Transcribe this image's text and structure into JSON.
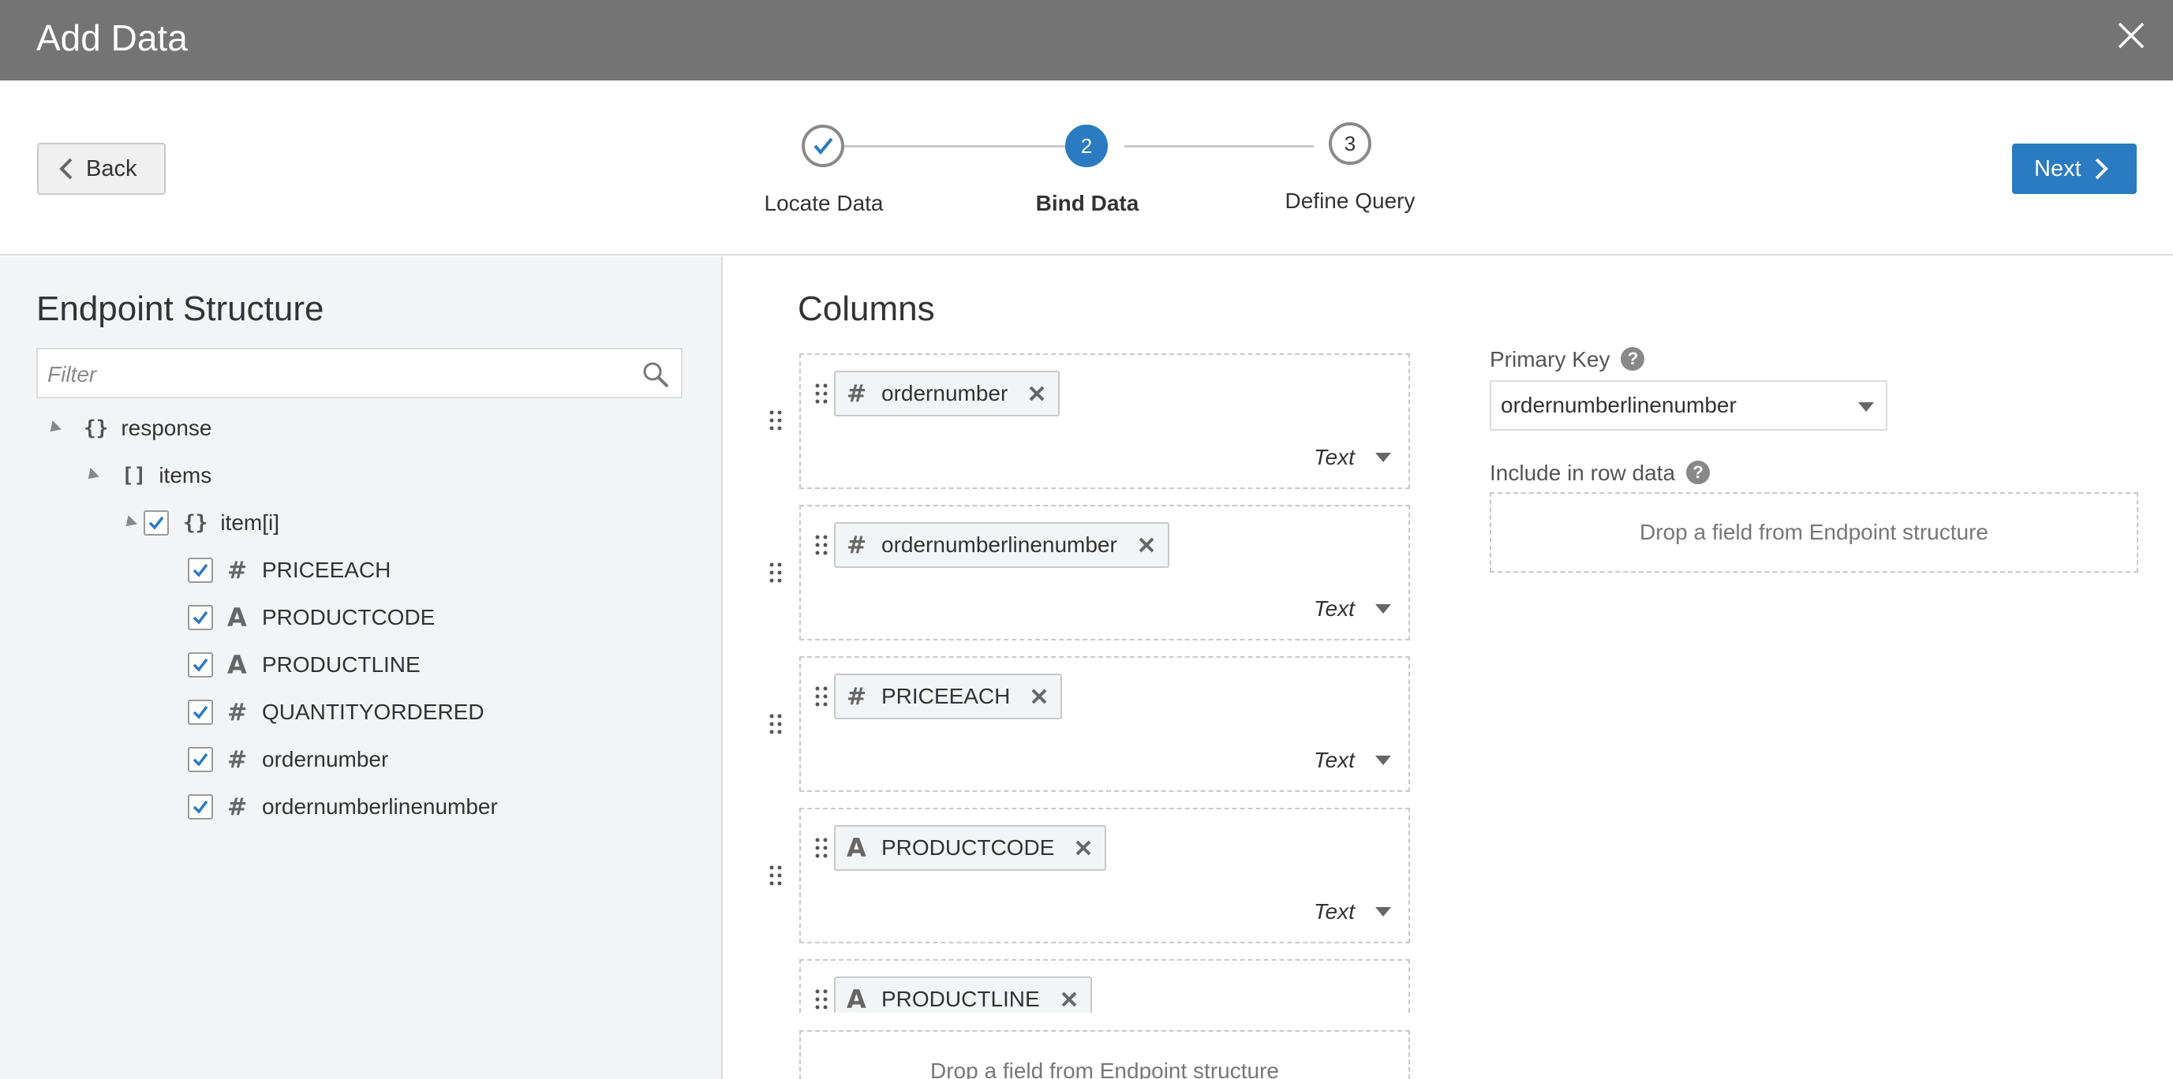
{
  "dialog": {
    "title": "Add Data"
  },
  "wizard": {
    "back_label": "Back",
    "next_label": "Next",
    "steps": [
      {
        "number": "",
        "label": "Locate Data",
        "state": "complete"
      },
      {
        "number": "2",
        "label": "Bind Data",
        "state": "active"
      },
      {
        "number": "3",
        "label": "Define Query",
        "state": "pending"
      }
    ]
  },
  "endpoint": {
    "title": "Endpoint Structure",
    "filter_placeholder": "Filter",
    "tree": [
      {
        "label": "response",
        "kind": "object"
      },
      {
        "label": "items",
        "kind": "array"
      },
      {
        "label": "item[i]",
        "kind": "object",
        "checked": true
      },
      {
        "label": "PRICEEACH",
        "type": "number",
        "checked": true
      },
      {
        "label": "PRODUCTCODE",
        "type": "text",
        "checked": true
      },
      {
        "label": "PRODUCTLINE",
        "type": "text",
        "checked": true
      },
      {
        "label": "QUANTITYORDERED",
        "type": "number",
        "checked": true
      },
      {
        "label": "ordernumber",
        "type": "number",
        "checked": true
      },
      {
        "label": "ordernumberlinenumber",
        "type": "number",
        "checked": true
      }
    ]
  },
  "columns": {
    "title": "Columns",
    "items": [
      {
        "field": "ordernumber",
        "field_type": "number",
        "type_label": "Text"
      },
      {
        "field": "ordernumberlinenumber",
        "field_type": "number",
        "type_label": "Text"
      },
      {
        "field": "PRICEEACH",
        "field_type": "number",
        "type_label": "Text"
      },
      {
        "field": "PRODUCTCODE",
        "field_type": "text",
        "type_label": "Text"
      },
      {
        "field": "PRODUCTLINE",
        "field_type": "text",
        "type_label": ""
      }
    ],
    "drop_hint": "Drop a field from Endpoint structure"
  },
  "primary_key": {
    "label": "Primary Key",
    "help": "?",
    "value": "ordernumberlinenumber"
  },
  "row_data": {
    "label": "Include in row data",
    "help": "?",
    "drop_hint": "Drop a field from Endpoint structure"
  },
  "colors": {
    "title_bar": "#747474",
    "accent": "#2a7bc1",
    "panel": "#f3f4f6"
  }
}
